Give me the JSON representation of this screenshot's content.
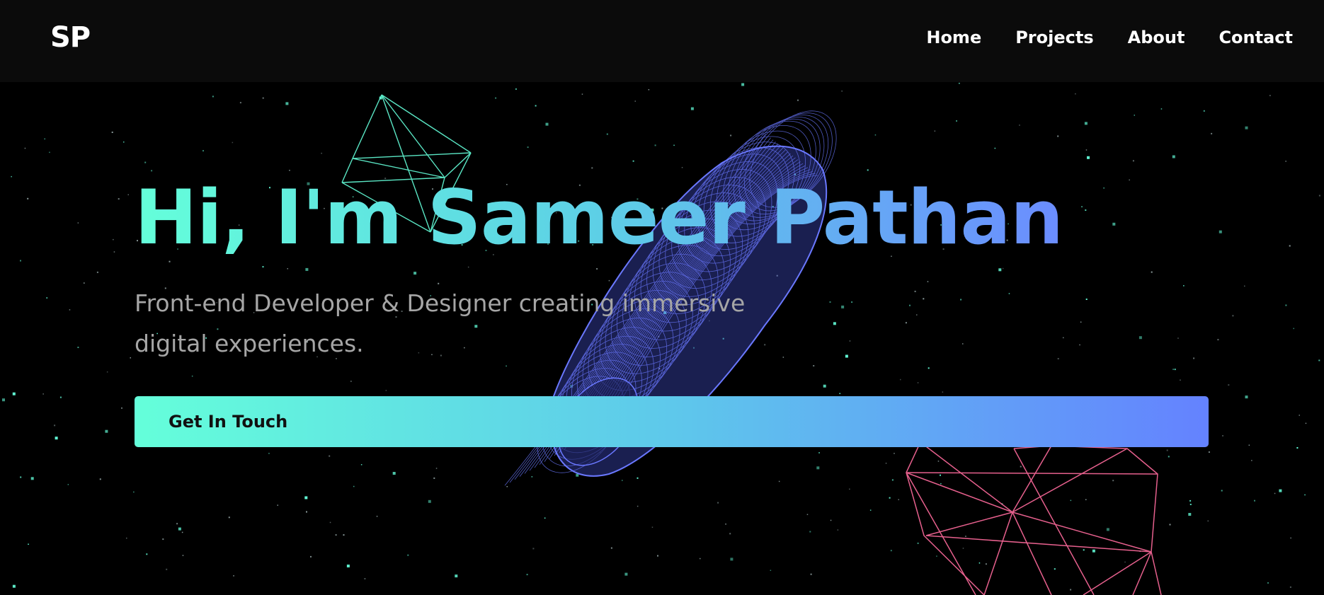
{
  "nav": {
    "logo": "SP",
    "links": [
      "Home",
      "Projects",
      "About",
      "Contact"
    ]
  },
  "hero": {
    "title": "Hi, I'm Sameer Pathan",
    "subtitle": "Front-end Developer & Designer creating immersive digital experiences.",
    "cta_label": "Get In Touch"
  },
  "colors": {
    "accent_teal": "#64ffda",
    "accent_blue": "#6482ff",
    "accent_pink": "#ff6b9d",
    "background": "#000000",
    "nav_background": "#0b0b0b"
  },
  "scene_objects": [
    "octahedron-wireframe",
    "torus-wireframe",
    "icosahedron-wireframe",
    "starfield"
  ]
}
